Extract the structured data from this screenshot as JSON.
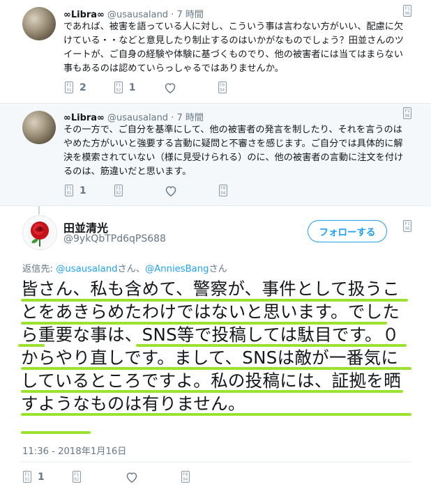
{
  "reply1": {
    "name": "∞Libra∞",
    "handle": "@usausaland",
    "time": "· 7 時間",
    "text": "であれば、被害を語っている人に対し、こういう事は言わない方がいい、配慮に欠けている・・などと意見したり制止するのはいかがなものでしょう？田並さんのツイートが、ご自身の経験や体験に基づくものでり、他の被害者には当てはまらない事もあるのは認めていらっしゃるではありませんか。",
    "reply_count": "2",
    "retweet_count": "1"
  },
  "reply2": {
    "name": "∞Libra∞",
    "handle": "@usausaland",
    "time": "· 7 時間",
    "text": "その一方で、ご自分を基準にして、他の被害者の発言を制したり、それを言うのはやめた方がいいと強要する言動に疑問と不審さを感じます。ご自分では具体的に解決を模索されていない（様に見受けられる）のに、他の被害者の言動に注文を付けるのは、筋違いだと思います。",
    "reply_count": "1"
  },
  "main": {
    "name": "田並清光",
    "handle": "@9ykQbTPd6qPS688",
    "follow_label": "フォローする",
    "replying_prefix": "返信先: ",
    "replying_user1": "@usausaland",
    "replying_mid": "さん、",
    "replying_user2": "@AnniesBang",
    "replying_suffix": "さん",
    "text": "皆さん、私も含めて、警察が、事件として扱うことをあきらめたわけではないと思います。でしたら重要な事は、SNS等で投稿しては駄目です。０からやり直しです。まして、SNSは敵が一番気にしているところですよ。私の投稿には、証拠を晒すようなものは有りません。",
    "timestamp": "11:36 - 2018年1月16日",
    "reply_count": "1"
  },
  "icons": {
    "reply_glyph": "F1\n91",
    "retweet_glyph": "F1\n92",
    "dm_glyph": "F0\n94",
    "caret_glyph": "F1\n96"
  },
  "colors": {
    "accent": "#1da1f2",
    "highlight": "#9be22e"
  }
}
